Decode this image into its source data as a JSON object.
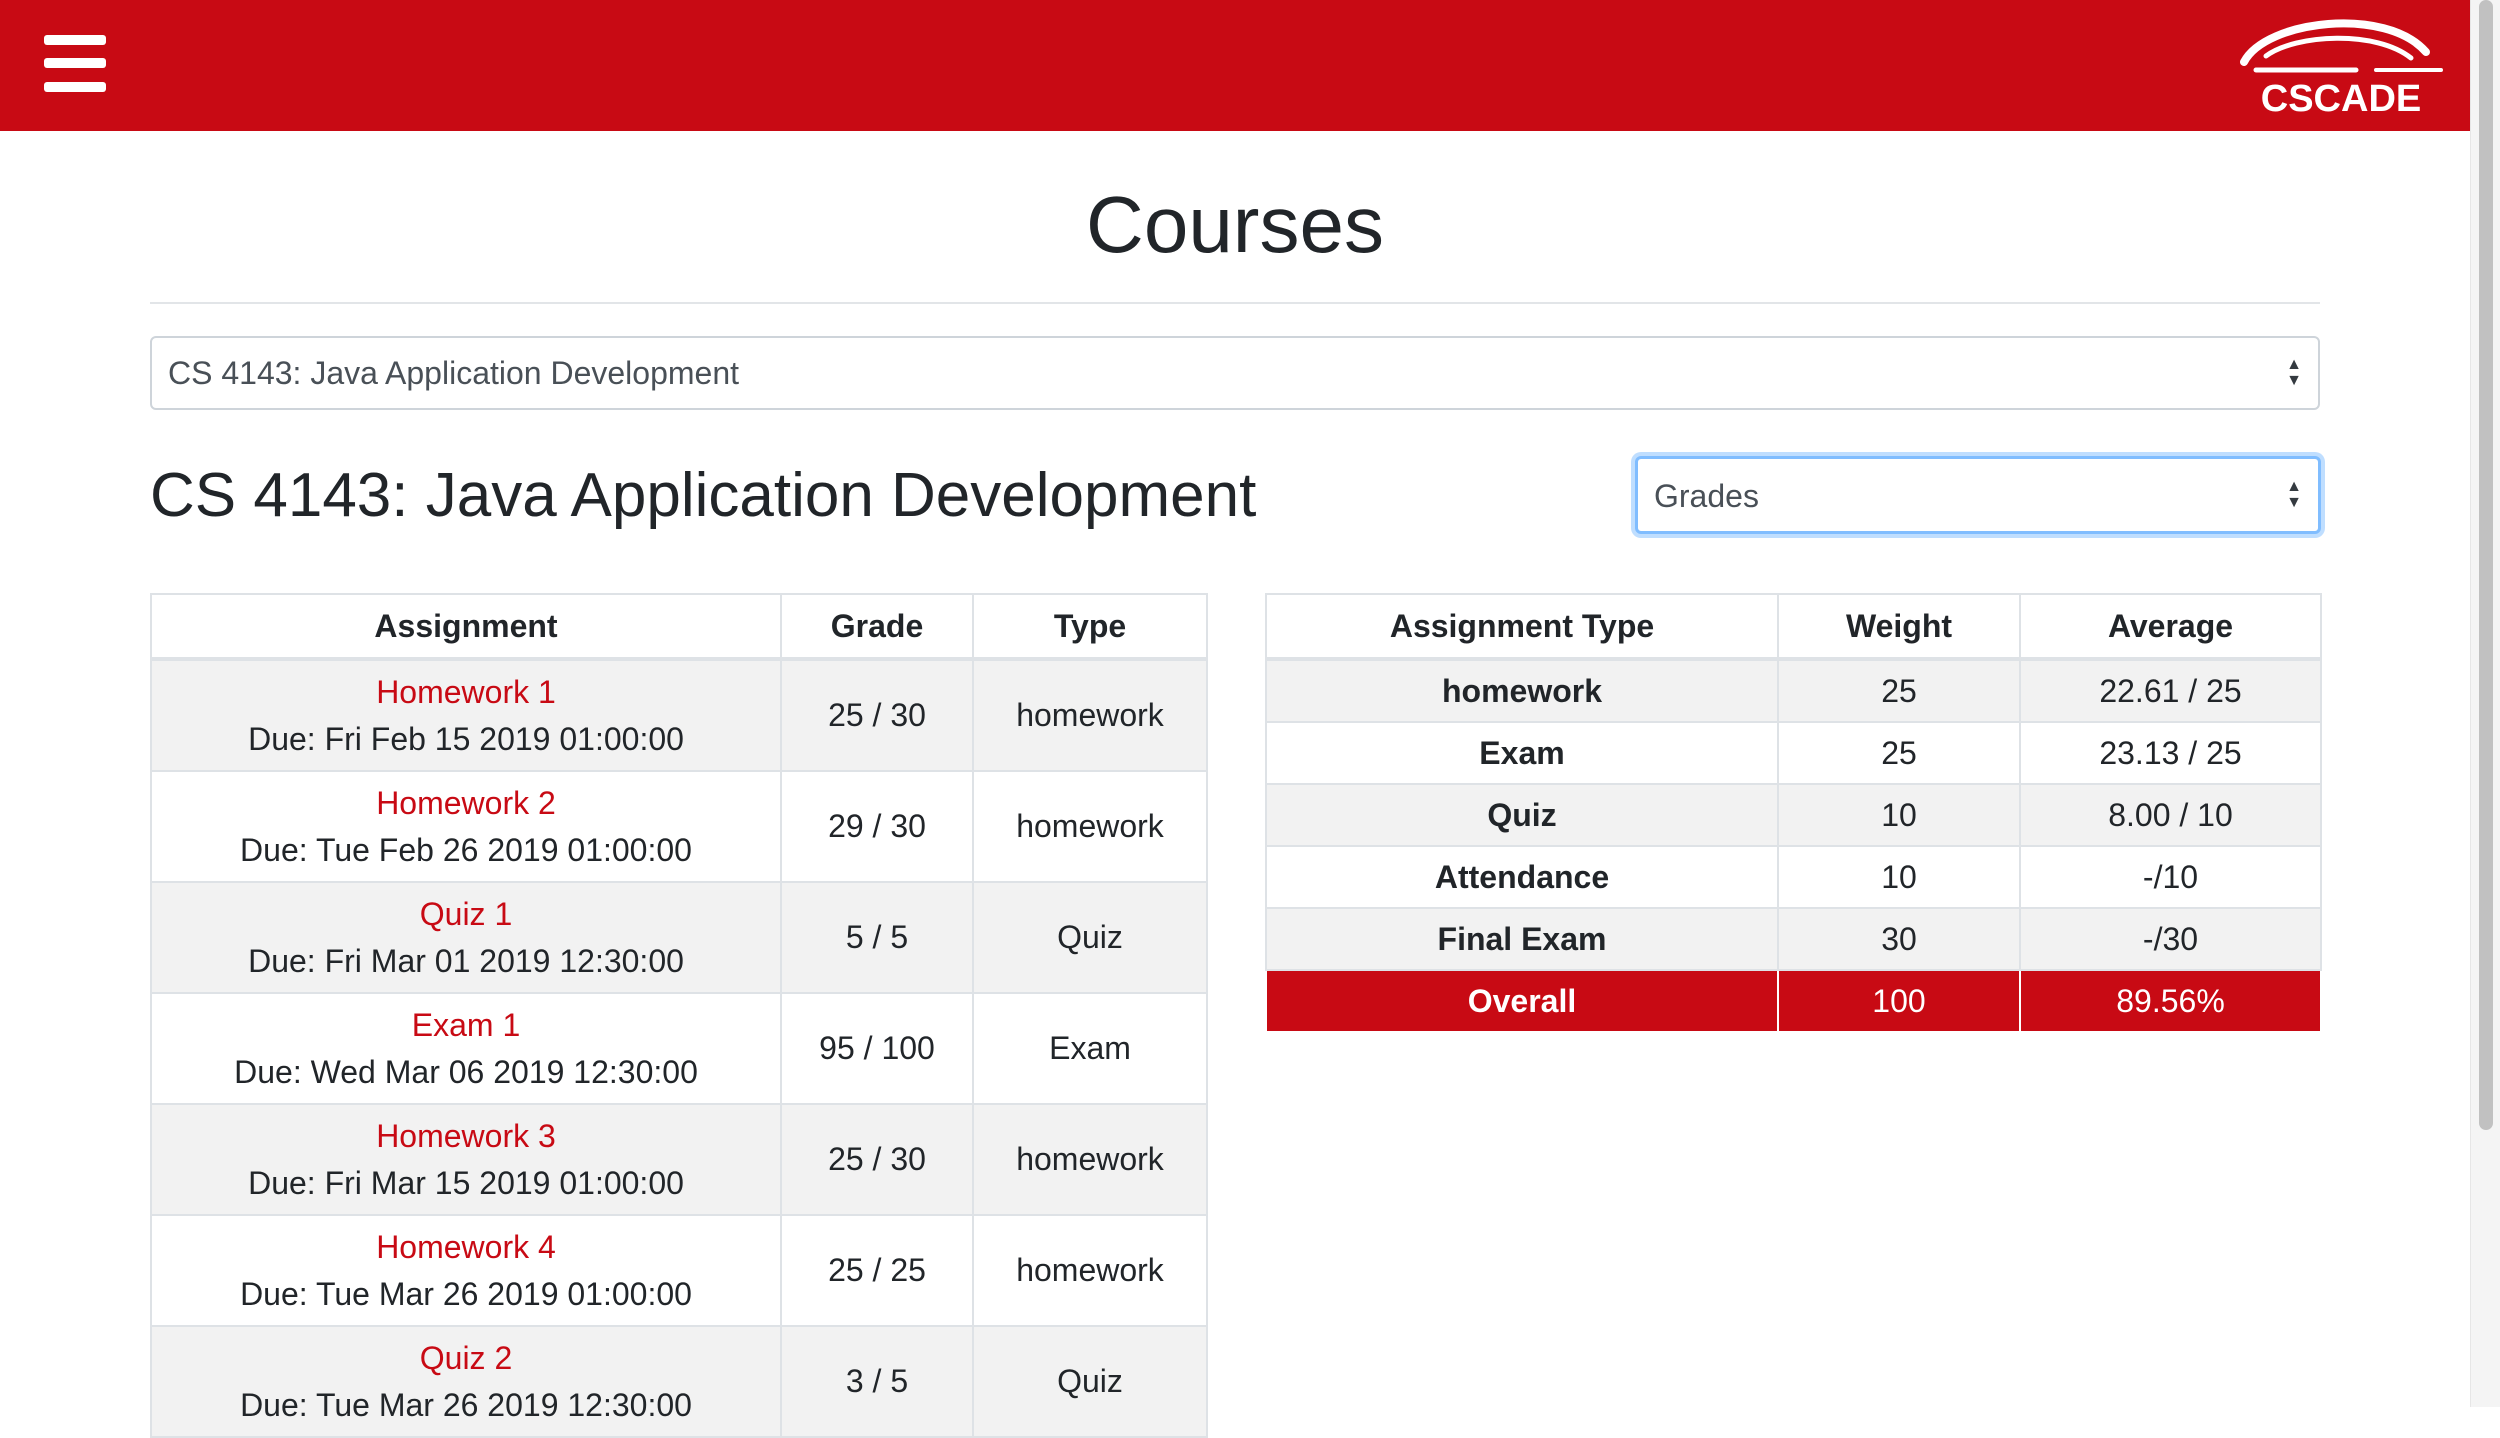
{
  "navbar": {
    "menu_icon": "hamburger-menu-icon",
    "logo_text": "CSCADE",
    "brand_color": "#c80a14"
  },
  "page": {
    "title": "Courses"
  },
  "course_select": {
    "value": "CS 4143: Java Application Development"
  },
  "course": {
    "heading": "CS 4143: Java Application Development"
  },
  "view_select": {
    "value": "Grades"
  },
  "assignments": {
    "headers": [
      "Assignment",
      "Grade",
      "Type"
    ],
    "rows": [
      {
        "name": "Homework 1",
        "due": "Due: Fri Feb 15 2019 01:00:00",
        "grade": "25 / 30",
        "type": "homework"
      },
      {
        "name": "Homework 2",
        "due": "Due: Tue Feb 26 2019 01:00:00",
        "grade": "29 / 30",
        "type": "homework"
      },
      {
        "name": "Quiz 1",
        "due": "Due: Fri Mar 01 2019 12:30:00",
        "grade": "5 / 5",
        "type": "Quiz"
      },
      {
        "name": "Exam 1",
        "due": "Due: Wed Mar 06 2019 12:30:00",
        "grade": "95 / 100",
        "type": "Exam"
      },
      {
        "name": "Homework 3",
        "due": "Due: Fri Mar 15 2019 01:00:00",
        "grade": "25 / 30",
        "type": "homework"
      },
      {
        "name": "Homework 4",
        "due": "Due: Tue Mar 26 2019 01:00:00",
        "grade": "25 / 25",
        "type": "homework"
      },
      {
        "name": "Quiz 2",
        "due": "Due: Tue Mar 26 2019 12:30:00",
        "grade": "3 / 5",
        "type": "Quiz"
      }
    ]
  },
  "types": {
    "headers": [
      "Assignment Type",
      "Weight",
      "Average"
    ],
    "rows": [
      {
        "type": "homework",
        "weight": "25",
        "average": "22.61 / 25"
      },
      {
        "type": "Exam",
        "weight": "25",
        "average": "23.13 / 25"
      },
      {
        "type": "Quiz",
        "weight": "10",
        "average": "8.00 / 10"
      },
      {
        "type": "Attendance",
        "weight": "10",
        "average": "-/10"
      },
      {
        "type": "Final Exam",
        "weight": "30",
        "average": "-/30"
      }
    ],
    "overall": {
      "type": "Overall",
      "weight": "100",
      "average": "89.56%"
    }
  }
}
